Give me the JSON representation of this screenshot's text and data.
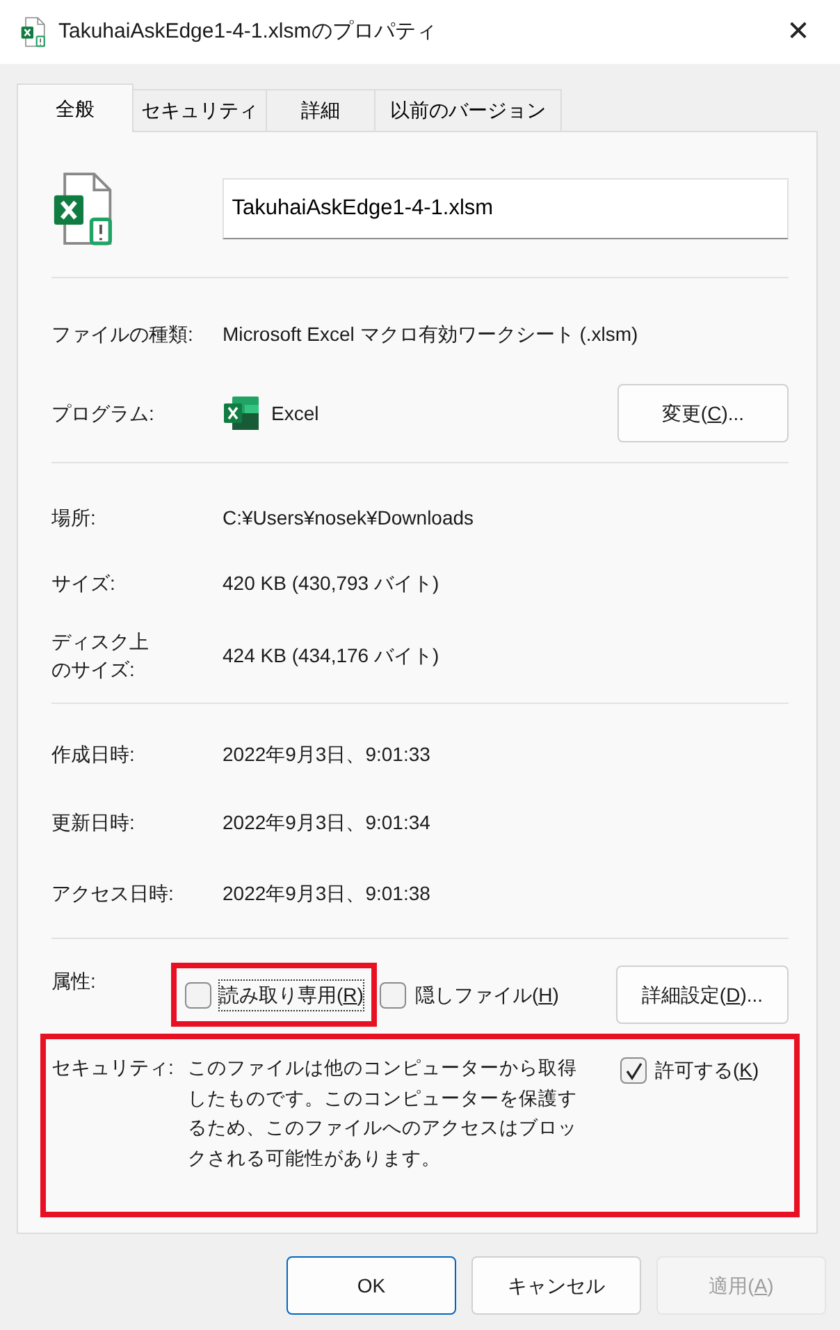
{
  "window": {
    "title": "TakuhaiAskEdge1-4-1.xlsmのプロパティ",
    "close": "✕"
  },
  "tabs": [
    {
      "label": "全般",
      "selected": true
    },
    {
      "label": "セキュリティ",
      "selected": false
    },
    {
      "label": "詳細",
      "selected": false
    },
    {
      "label": "以前のバージョン",
      "selected": false
    }
  ],
  "file_name": {
    "value": "TakuhaiAskEdge1-4-1.xlsm"
  },
  "sections": [
    {
      "rows": [
        {
          "kind": "text",
          "label": "ファイルの種類:",
          "value": "Microsoft Excel マクロ有効ワークシート (.xlsm)"
        },
        {
          "kind": "program",
          "label": "プログラム:",
          "value": "Excel",
          "button": [
            "変更(",
            "C",
            ")..."
          ]
        }
      ]
    },
    {
      "rows": [
        {
          "kind": "text",
          "label": "場所:",
          "value": "C:¥Users¥nosek¥Downloads"
        },
        {
          "kind": "text",
          "label": "サイズ:",
          "value": "420 KB (430,793 バイト)"
        },
        {
          "kind": "text",
          "label": [
            "ディスク上",
            "のサイズ:"
          ],
          "value": "424 KB (434,176 バイト)"
        }
      ]
    },
    {
      "rows": [
        {
          "kind": "text",
          "label": "作成日時:",
          "value": "2022年9月3日、9:01:33"
        },
        {
          "kind": "text",
          "label": "更新日時:",
          "value": "2022年9月3日、9:01:34"
        },
        {
          "kind": "text",
          "label": "アクセス日時:",
          "value": "2022年9月3日、9:01:38"
        }
      ]
    }
  ],
  "attributes": {
    "label": "属性:",
    "checkboxes": [
      {
        "label": [
          "読み取り専用(",
          "R",
          ")"
        ],
        "checked": false,
        "highlight": true,
        "focused": true
      },
      {
        "label": [
          "隠しファイル(",
          "H",
          ")"
        ],
        "checked": false,
        "highlight": false,
        "focused": false
      }
    ],
    "button": [
      "詳細設定(",
      "D",
      ")..."
    ]
  },
  "security": {
    "label": "セキュリティ:",
    "message": "このファイルは他のコンピューターから取得したものです。このコンピューターを保護するため、このファイルへのアクセスはブロックされる可能性があります。",
    "checkbox": {
      "label": [
        "許可する(",
        "K",
        ")"
      ],
      "checked": true
    },
    "highlight": true
  },
  "buttons": [
    {
      "label": [
        "OK"
      ],
      "default": true,
      "disabled": false
    },
    {
      "label": [
        "キャンセル"
      ],
      "default": false,
      "disabled": false
    },
    {
      "label": [
        "適用(",
        "A",
        ")"
      ],
      "default": false,
      "disabled": true
    }
  ]
}
